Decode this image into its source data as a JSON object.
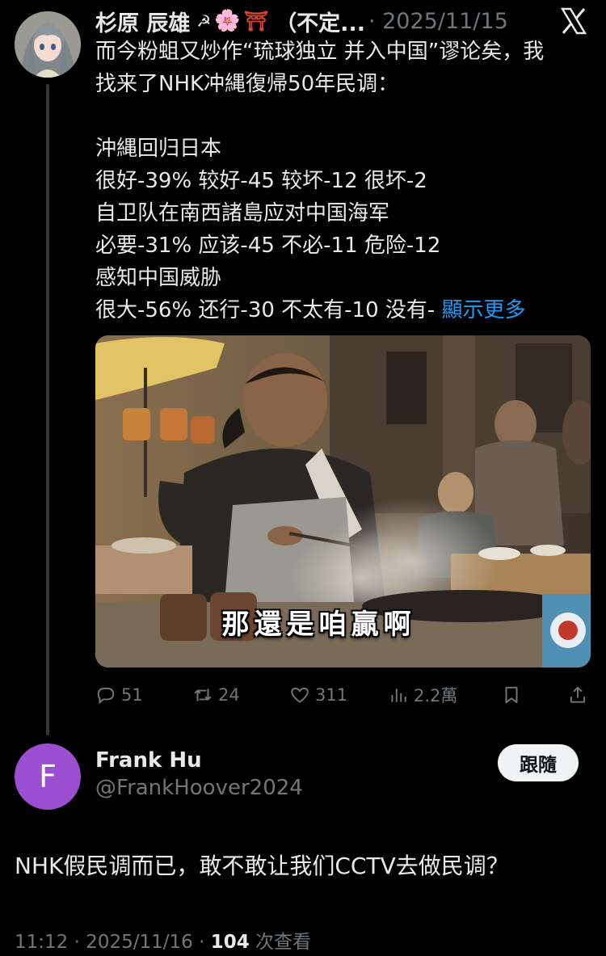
{
  "parent_tweet": {
    "display_name": "杉原 辰雄",
    "emoji_icons": [
      "☭",
      "🌸",
      "⛩"
    ],
    "name_suffix": "（不定...",
    "meta": "· 2025/11/15",
    "text_lines": [
      "而今粉蛆又炒作“琉球独立 并入中国”谬论矣，我",
      "找来了NHK冲縄復帰50年民调：",
      "",
      "沖縄回归日本",
      "很好-39% 较好-45 较坏-12 很坏-2",
      "自卫队在南西諸島应对中国海军",
      "必要-31% 应该-45 不必-11 危险-12",
      "感知中国威胁",
      "很大-56% 还行-30 不太有-10 没有-"
    ],
    "show_more": "顯示更多",
    "media_subtitle": "那還是咱贏啊",
    "actions": {
      "replies": "51",
      "reposts": "24",
      "likes": "311",
      "views": "2.2萬"
    }
  },
  "reply": {
    "avatar_letter": "F",
    "avatar_color": "#9c4ed1",
    "display_name": "Frank Hu",
    "handle": "@FrankHoover2024",
    "follow_label": "跟隨",
    "text": "NHK假民调而已，敢不敢让我们CCTV去做民调？",
    "time": "11:12 · 2025/11/16 · ",
    "views_count": "104",
    "views_label": " 次查看"
  },
  "colors": {
    "background": "#000000",
    "text": "#e7e9ea",
    "muted": "#71767b",
    "link": "#1d9bf0",
    "thread_line": "#333639"
  }
}
